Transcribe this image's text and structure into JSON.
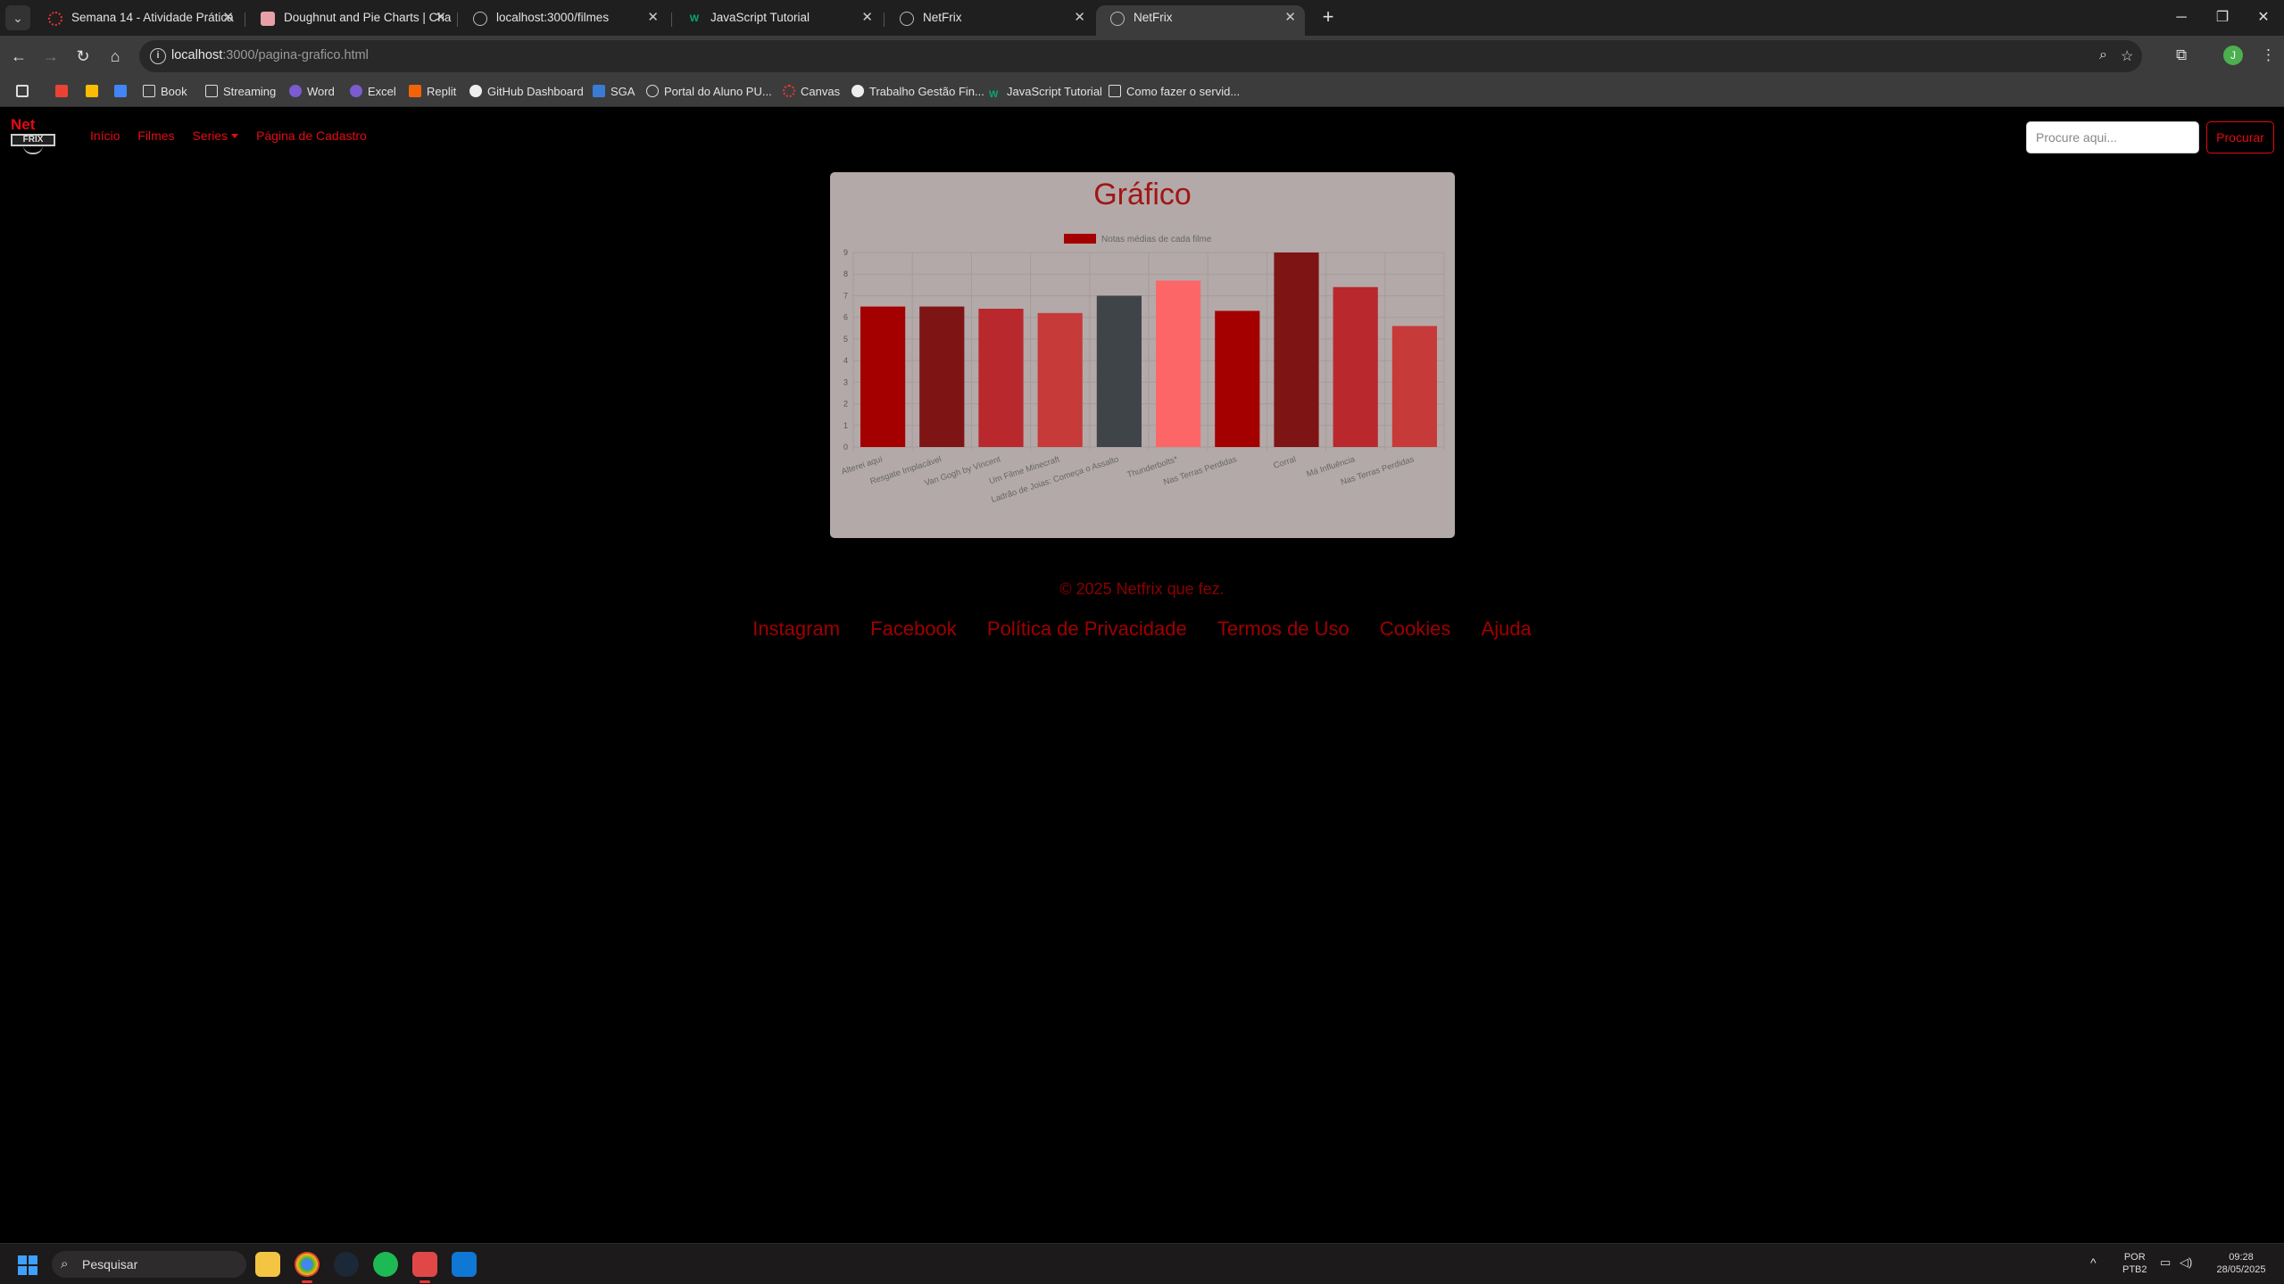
{
  "browser": {
    "tabs": [
      {
        "title": "Semana 14 - Atividade Prática",
        "icon": "canvas-icon",
        "active": false
      },
      {
        "title": "Doughnut and Pie Charts | Cha",
        "icon": "chartjs-icon",
        "active": false
      },
      {
        "title": "localhost:3000/filmes",
        "icon": "globe-icon",
        "active": false
      },
      {
        "title": "JavaScript Tutorial",
        "icon": "w3schools-icon",
        "active": false
      },
      {
        "title": "NetFrix",
        "icon": "globe-icon",
        "active": false
      },
      {
        "title": "NetFrix",
        "icon": "globe-icon",
        "active": true
      }
    ],
    "url_host": "localhost",
    "url_path": ":3000/pagina-grafico.html",
    "bookmarks": [
      {
        "label": "",
        "icon": "apps-icon"
      },
      {
        "label": "",
        "icon": "gmail-icon"
      },
      {
        "label": "",
        "icon": "drive-icon"
      },
      {
        "label": "",
        "icon": "photos-icon"
      },
      {
        "label": "Book",
        "icon": "folder-icon"
      },
      {
        "label": "Streaming",
        "icon": "folder-icon"
      },
      {
        "label": "Word",
        "icon": "copilot-icon"
      },
      {
        "label": "Excel",
        "icon": "copilot-icon"
      },
      {
        "label": "Replit",
        "icon": "replit-icon"
      },
      {
        "label": "GitHub Dashboard",
        "icon": "github-icon"
      },
      {
        "label": "SGA",
        "icon": "sga-icon"
      },
      {
        "label": "Portal do Aluno PU...",
        "icon": "portal-icon"
      },
      {
        "label": "Canvas",
        "icon": "canvas-icon"
      },
      {
        "label": "Trabalho Gestão Fin...",
        "icon": "github-icon"
      },
      {
        "label": "JavaScript Tutorial",
        "icon": "w3schools-icon"
      },
      {
        "label": "Como fazer o servid...",
        "icon": "bookmark-page-icon"
      }
    ]
  },
  "site": {
    "logo_text": "Net",
    "logo_sub": "FRIX",
    "nav": [
      "Início",
      "Filmes",
      "Series",
      "Página de Cadastro"
    ],
    "search_placeholder": "Procure aqui...",
    "search_button": "Procurar",
    "chart_heading": "Gráfico",
    "footer_copy": "© 2025 Netfrix que fez.",
    "footer_links": [
      "Instagram",
      "Facebook",
      "Política de Privacidade",
      "Termos de Uso",
      "Cookies",
      "Ajuda"
    ]
  },
  "chart_data": {
    "type": "bar",
    "title": "Gráfico",
    "legend": "Notas médias de cada filme",
    "legend_position": "top",
    "categories": [
      "Alterei aqui",
      "Resgate Implacável",
      "Van Gogh by Vincent",
      "Um Filme Minecraft",
      "Ladrão de Joias: Começa o Assalto",
      "Thunderbolts*",
      "Nas Terras Perdidas",
      "Corral",
      "Má Influência",
      "Nas Terras Perdidas"
    ],
    "values": [
      6.5,
      6.5,
      6.4,
      6.2,
      7.0,
      7.7,
      6.3,
      9.0,
      7.4,
      5.6
    ],
    "colors": [
      "#a50000",
      "#7e1414",
      "#b8282c",
      "#c73a3a",
      "#3f4448",
      "#fd6666",
      "#a50000",
      "#7e1414",
      "#b8282c",
      "#c73a3a"
    ],
    "ylim": [
      0,
      9
    ],
    "yticks": [
      0,
      1,
      2,
      3,
      4,
      5,
      6,
      7,
      8,
      9
    ],
    "grid": true
  },
  "taskbar": {
    "search_label": "Pesquisar",
    "lang_top": "POR",
    "lang_bottom": "PTB2",
    "time": "09:28",
    "date": "28/05/2025"
  }
}
